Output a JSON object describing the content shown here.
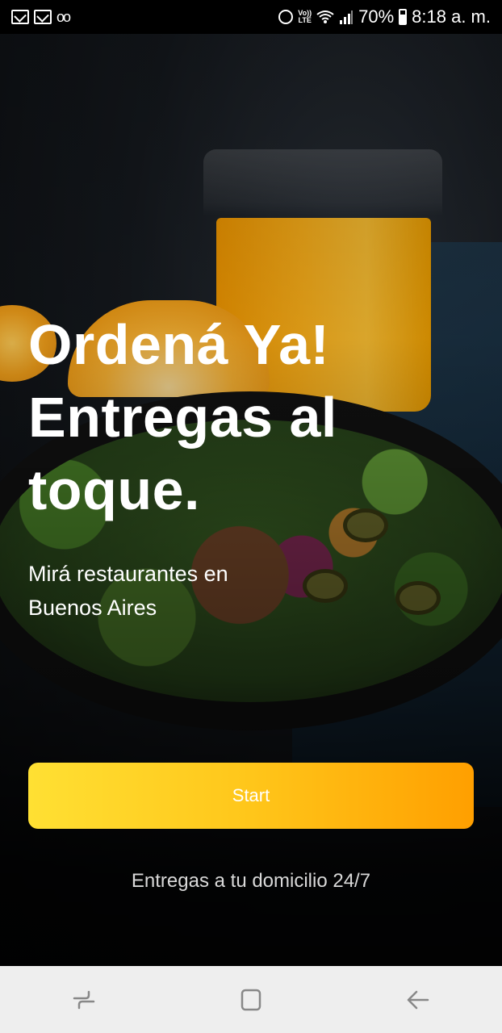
{
  "status_bar": {
    "left_icons": [
      "mail-icon",
      "mail-icon",
      "voicemail-icon"
    ],
    "volte_label_top": "Vo))",
    "volte_label_bottom": "LTE",
    "battery_percent": "70%",
    "time": "8:18 a. m."
  },
  "hero": {
    "headline_lines": [
      "Ordená Ya!",
      "Entregas al",
      "toque."
    ],
    "subtitle_lines": [
      "Mirá restaurantes en",
      "Buenos Aires"
    ]
  },
  "start_button": {
    "label": "Start"
  },
  "footer_note": "Entregas a tu domicilio 24/7",
  "colors": {
    "button_gradient_start": "#ffe033",
    "button_gradient_end": "#ff9f00",
    "nav_bar_bg": "#eeeeee"
  },
  "nav_bar": {
    "buttons": [
      "recent-apps-icon",
      "home-icon",
      "back-icon"
    ]
  }
}
